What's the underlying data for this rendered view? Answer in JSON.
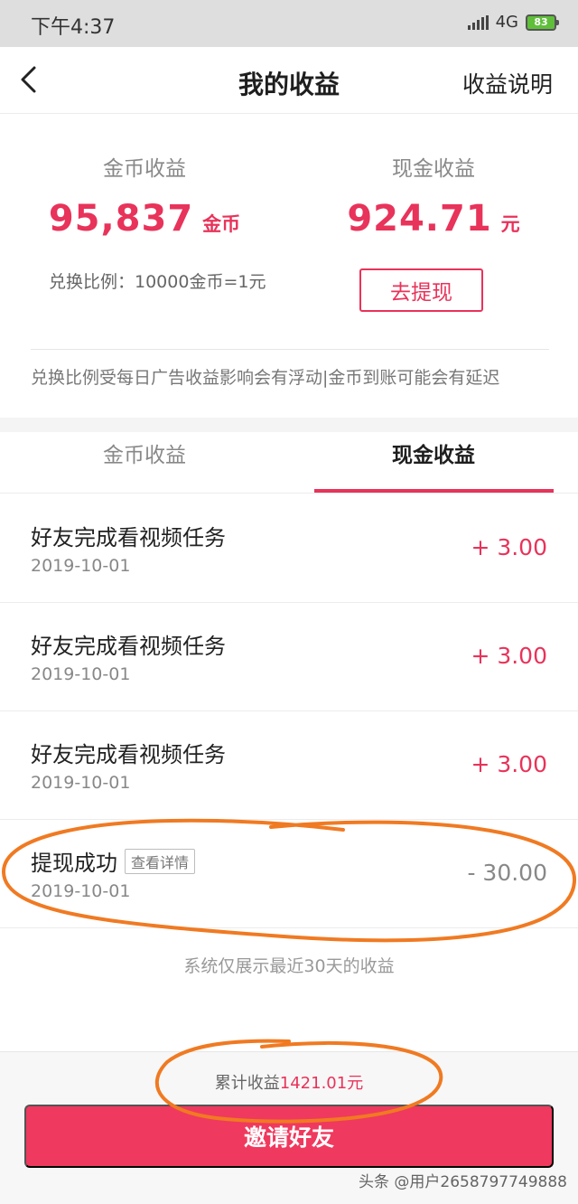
{
  "status_bar": {
    "time": "下午4:37",
    "network": "4G",
    "battery": "83"
  },
  "nav": {
    "title": "我的收益",
    "right_link": "收益说明",
    "back_icon": "chevron-left-icon"
  },
  "summary": {
    "coin_label": "金币收益",
    "coin_value": "95,837",
    "coin_unit": "金币",
    "cash_label": "现金收益",
    "cash_value": "924.71",
    "cash_unit": "元",
    "rate_text": "兑换比例：10000金币=1元",
    "withdraw_button": "去提现",
    "notice": "兑换比例受每日广告收益影响会有浮动|金币到账可能会有延迟"
  },
  "tabs": [
    {
      "label": "金币收益",
      "active": false
    },
    {
      "label": "现金收益",
      "active": true
    }
  ],
  "records": [
    {
      "title": "好友完成看视频任务",
      "date": "2019-10-01",
      "amount": "+ 3.00"
    },
    {
      "title": "好友完成看视频任务",
      "date": "2019-10-01",
      "amount": "+ 3.00"
    },
    {
      "title": "好友完成看视频任务",
      "date": "2019-10-01",
      "amount": "+ 3.00"
    },
    {
      "title": "提现成功",
      "tag": "查看详情",
      "date": "2019-10-01",
      "amount": "- 30.00"
    }
  ],
  "footnote": "系统仅展示最近30天的收益",
  "bottom": {
    "total_prefix": "累计收益",
    "total_value": "1421.01元",
    "invite_button": "邀请好友"
  },
  "watermark": "头条 @用户2658797749888",
  "colors": {
    "accent": "#e8335a",
    "annotation": "#f07a22"
  }
}
